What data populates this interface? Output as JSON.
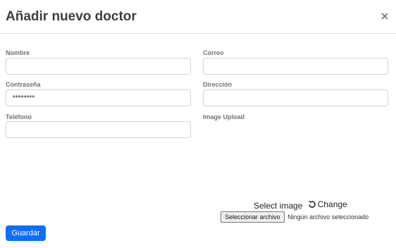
{
  "modal": {
    "title": "Añadir nuevo doctor",
    "close_icon": "close-icon"
  },
  "form": {
    "nombre": {
      "label": "Nombre",
      "value": ""
    },
    "correo": {
      "label": "Correo",
      "value": ""
    },
    "contrasena": {
      "label": "Contraseña",
      "value": "********"
    },
    "direccion": {
      "label": "Dirección",
      "value": ""
    },
    "telefono": {
      "label": "Teléfono",
      "value": ""
    },
    "image_upload": {
      "label": "Image Upload",
      "select_label": "Select image",
      "change_label": "Change",
      "change_icon": "undo-icon",
      "file_button_label": "Seleccionar archivo",
      "file_status": "Ningún archivo seleccionado"
    }
  },
  "actions": {
    "save_label": "Guardar"
  },
  "colors": {
    "primary": "#0d6efd",
    "label": "#6c757d",
    "border": "#ced4da"
  }
}
